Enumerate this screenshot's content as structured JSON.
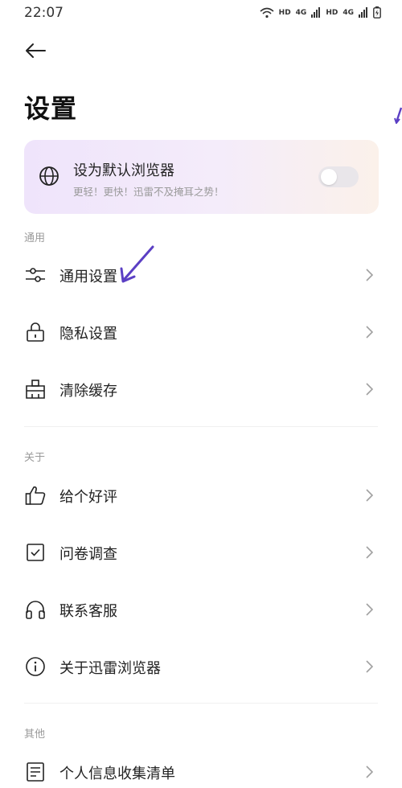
{
  "status_bar": {
    "time": "22:07",
    "hd1": "HD",
    "net1": "4G",
    "hd2": "HD",
    "net2": "4G"
  },
  "header": {
    "title": "设置"
  },
  "default_browser": {
    "title": "设为默认浏览器",
    "subtitle": "更轻！更快！迅雷不及掩耳之势！",
    "enabled": false
  },
  "sections": [
    {
      "label": "通用",
      "items": [
        {
          "label": "通用设置",
          "icon": "sliders-icon"
        },
        {
          "label": "隐私设置",
          "icon": "lock-icon"
        },
        {
          "label": "清除缓存",
          "icon": "broom-icon"
        }
      ]
    },
    {
      "label": "关于",
      "items": [
        {
          "label": "给个好评",
          "icon": "thumbs-up-icon"
        },
        {
          "label": "问卷调查",
          "icon": "checkbox-icon"
        },
        {
          "label": "联系客服",
          "icon": "headphones-icon"
        },
        {
          "label": "关于迅雷浏览器",
          "icon": "info-icon"
        }
      ]
    },
    {
      "label": "其他",
      "items": [
        {
          "label": "个人信息收集清单",
          "icon": "list-icon"
        }
      ]
    }
  ],
  "colors": {
    "accent_arrow": "#5b3fc4",
    "card_gradient_start": "#efe4fb",
    "card_gradient_end": "#fbf1ea"
  }
}
